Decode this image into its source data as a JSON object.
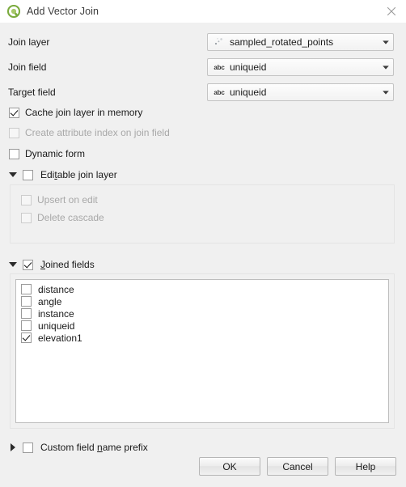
{
  "window": {
    "title": "Add Vector Join",
    "app_icon": "qgis-logo-icon",
    "close_icon": "close-icon"
  },
  "fields": [
    {
      "label": "Join layer",
      "icon": "point-layer-icon",
      "value": "sampled_rotated_points"
    },
    {
      "label": "Join field",
      "icon": "abc-text-field-icon",
      "icon_text": "abc",
      "value": "uniqueid"
    },
    {
      "label": "Target field",
      "icon": "abc-text-field-icon",
      "icon_text": "abc",
      "value": "uniqueid"
    }
  ],
  "options": [
    {
      "label": "Cache join layer in memory",
      "checked": true,
      "disabled": false
    },
    {
      "label": "Create attribute index on join field",
      "checked": false,
      "disabled": true
    },
    {
      "label": "Dynamic form",
      "checked": false,
      "disabled": false
    }
  ],
  "editable_group": {
    "label_pre": "Edi",
    "label_mnemonic": "t",
    "label_post": "able join layer",
    "checked": false,
    "expanded": true,
    "children": [
      {
        "label": "Upsert on edit",
        "checked": false,
        "disabled": true
      },
      {
        "label": "Delete cascade",
        "checked": false,
        "disabled": true
      }
    ]
  },
  "joined_fields_group": {
    "label_mnemonic": "J",
    "label_post": "oined fields",
    "checked": true,
    "expanded": true,
    "items": [
      {
        "label": "distance",
        "checked": false
      },
      {
        "label": "angle",
        "checked": false
      },
      {
        "label": "instance",
        "checked": false
      },
      {
        "label": "uniqueid",
        "checked": false
      },
      {
        "label": "elevation1",
        "checked": true
      }
    ]
  },
  "prefix_group": {
    "label_pre": "Custom field ",
    "label_mnemonic": "n",
    "label_post": "ame prefix",
    "checked": false,
    "expanded": false
  },
  "buttons": [
    {
      "label": "OK"
    },
    {
      "label": "Cancel"
    },
    {
      "label": "Help"
    }
  ],
  "colors": {
    "dialog_background": "#f0f0f0",
    "titlebar_background": "#ffffff",
    "list_background": "#ffffff",
    "accent_green": "#7bab3e"
  }
}
